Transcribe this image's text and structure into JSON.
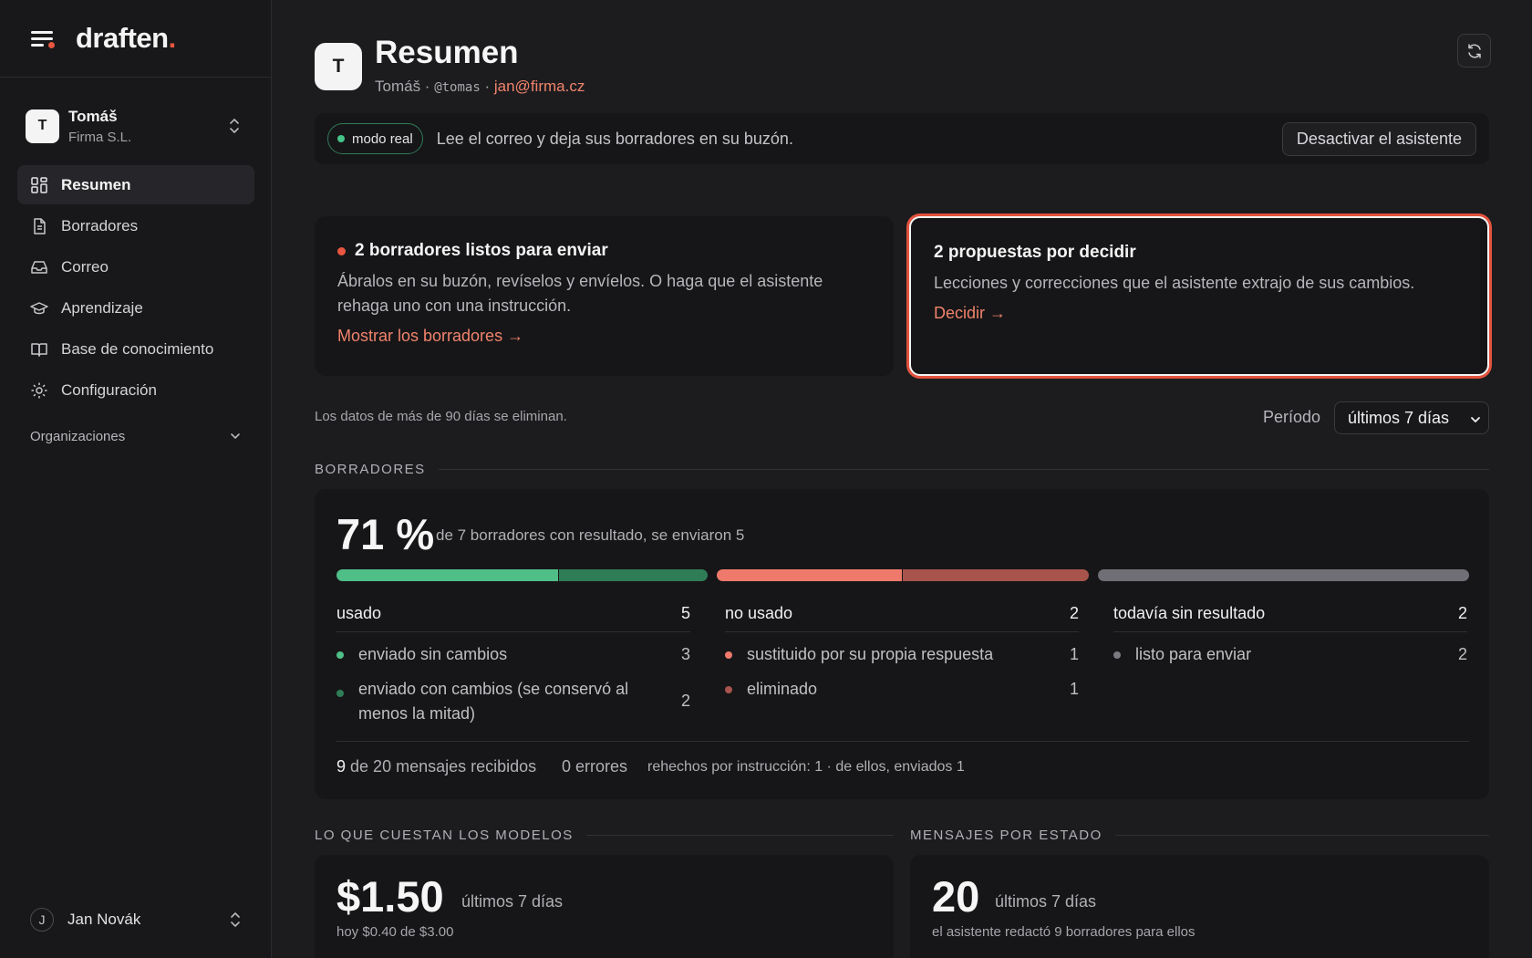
{
  "brand": {
    "name": "draften",
    "dot": "."
  },
  "workspace": {
    "avatar": "T",
    "name": "Tomáš",
    "org": "Firma S.L."
  },
  "nav": [
    {
      "label": "Resumen",
      "icon": "dashboard-icon",
      "active": true
    },
    {
      "label": "Borradores",
      "icon": "document-icon"
    },
    {
      "label": "Correo",
      "icon": "inbox-icon"
    },
    {
      "label": "Aprendizaje",
      "icon": "graduation-cap-icon"
    },
    {
      "label": "Base de conocimiento",
      "icon": "book-icon"
    },
    {
      "label": "Configuración",
      "icon": "gear-icon"
    }
  ],
  "organizations_label": "Organizaciones",
  "user": {
    "avatar": "J",
    "name": "Jan Novák"
  },
  "header": {
    "avatar": "T",
    "title": "Resumen",
    "name": "Tomáš",
    "sep1": " · ",
    "handle": "@tomas",
    "sep2": " · ",
    "email": "jan@firma.cz"
  },
  "mode": {
    "badge": "modo real",
    "text": "Lee el correo y deja sus borradores en su buzón.",
    "button": "Desactivar el asistente"
  },
  "callouts": [
    {
      "title": "2 borradores listos para enviar",
      "body": "Ábralos en su buzón, revíselos y envíelos. O haga que el asistente rehaga uno con una instrucción.",
      "link": "Mostrar los borradores →"
    },
    {
      "title": "2 propuestas por decidir",
      "body": "Lecciones y correcciones que el asistente extrajo de sus cambios.",
      "link": "Decidir →"
    }
  ],
  "retention_note": "Los datos de más de 90 días se eliminan.",
  "period": {
    "label": "Período",
    "selected": "últimos 7 días"
  },
  "drafts": {
    "section_title": "BORRADORES",
    "percent": "71 %",
    "summary": "de 7 borradores con resultado, se enviaron 5",
    "bar": [
      {
        "name": "enviado sin cambios",
        "value": 3,
        "color": "#4fbf87"
      },
      {
        "name": "enviado con cambios",
        "value": 2,
        "color": "#2f7d57"
      },
      {
        "name": "sustituido",
        "value": 1,
        "color": "#ef7a6b"
      },
      {
        "name": "eliminado",
        "value": 1,
        "color": "#a8544c"
      },
      {
        "name": "listo para enviar",
        "value": 2,
        "color": "#6f6f75"
      }
    ],
    "columns": [
      {
        "title": "usado",
        "total": "5",
        "rows": [
          {
            "label": "enviado sin cambios",
            "value": "3",
            "color": "#4fbf87"
          },
          {
            "label": "enviado con cambios (se conservó al menos la mitad)",
            "value": "2",
            "color": "#2f7d57"
          }
        ]
      },
      {
        "title": "no usado",
        "total": "2",
        "rows": [
          {
            "label": "sustituido por su propia respuesta",
            "value": "1",
            "color": "#ef7a6b"
          },
          {
            "label": "eliminado",
            "value": "1",
            "color": "#a8544c"
          }
        ]
      },
      {
        "title": "todavía sin resultado",
        "total": "2",
        "rows": [
          {
            "label": "listo para enviar",
            "value": "2",
            "color": "#7a7a80"
          }
        ]
      }
    ],
    "footer": {
      "received_count": "9",
      "received_text": "de 20 mensajes recibidos",
      "errors": "0 errores",
      "redone": "rehechos por instrucción: 1 · de ellos, enviados 1"
    }
  },
  "costs": {
    "section_title": "LO QUE CUESTAN LOS MODELOS",
    "amount": "$1.50",
    "period": "últimos 7 días",
    "today": "hoy $0.40 de $3.00"
  },
  "messages": {
    "section_title": "MENSAJES POR ESTADO",
    "count": "20",
    "period": "últimos 7 días",
    "note": "el asistente redactó 9 borradores para ellos"
  }
}
